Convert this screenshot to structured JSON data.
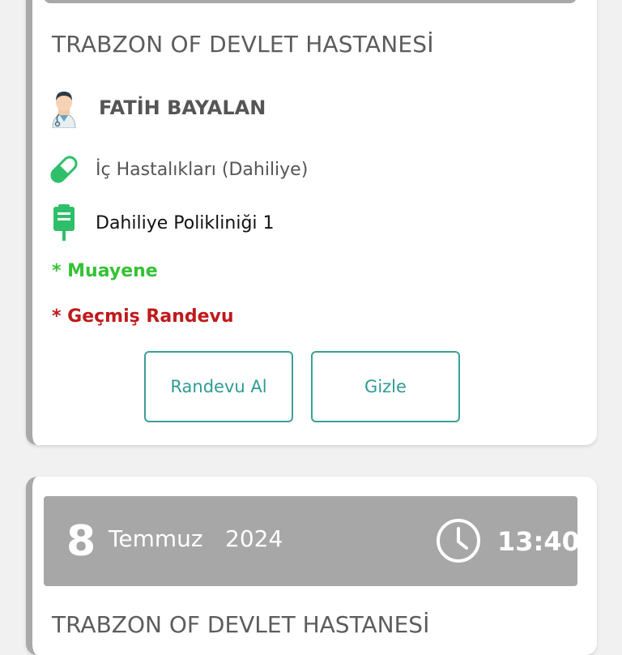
{
  "appointment_1": {
    "hospital": "TRABZON OF DEVLET HASTANESİ",
    "doctor": "FATİH BAYALAN",
    "department": "İç Hastalıkları (Dahiliye)",
    "clinic": "Dahiliye Polikliniği 1",
    "type_note": "* Muayene",
    "status_note": "* Geçmiş Randevu",
    "buttons": {
      "book_label": "Randevu Al",
      "hide_label": "Gizle"
    }
  },
  "appointment_2": {
    "day": "8",
    "month": "Temmuz",
    "year": "2024",
    "time": "13:40",
    "hospital": "TRABZON OF DEVLET HASTANESİ"
  },
  "colors": {
    "accent": "#3c9f98",
    "green": "#35c235",
    "red": "#c0191b",
    "date_bar": "#a7a7a7"
  },
  "icons": [
    "doctor-icon",
    "pill-icon",
    "clinic-icon",
    "clock-icon"
  ]
}
